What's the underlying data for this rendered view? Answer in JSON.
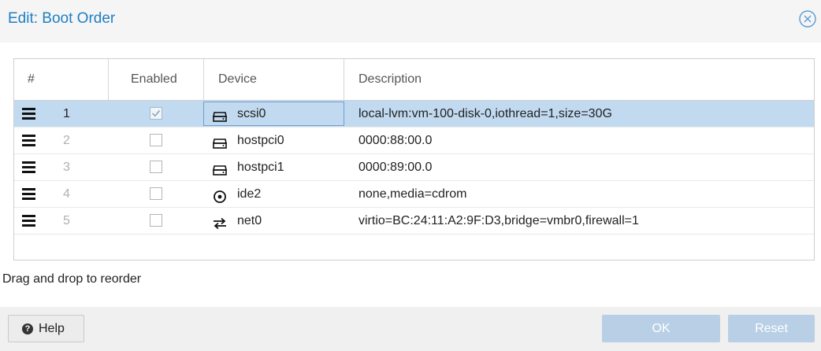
{
  "dialog": {
    "title": "Edit: Boot Order",
    "hint": "Drag and drop to reorder",
    "help_label": "Help",
    "ok_label": "OK",
    "reset_label": "Reset"
  },
  "grid": {
    "columns": [
      "#",
      "Enabled",
      "Device",
      "Description"
    ],
    "rows": [
      {
        "num": "1",
        "enabled": true,
        "device": "scsi0",
        "icon": "hdd-icon",
        "description": "local-lvm:vm-100-disk-0,iothread=1,size=30G",
        "selected": true
      },
      {
        "num": "2",
        "enabled": false,
        "device": "hostpci0",
        "icon": "hdd-icon",
        "description": "0000:88:00.0",
        "selected": false
      },
      {
        "num": "3",
        "enabled": false,
        "device": "hostpci1",
        "icon": "hdd-icon",
        "description": "0000:89:00.0",
        "selected": false
      },
      {
        "num": "4",
        "enabled": false,
        "device": "ide2",
        "icon": "cdrom-icon",
        "description": "none,media=cdrom",
        "selected": false
      },
      {
        "num": "5",
        "enabled": false,
        "device": "net0",
        "icon": "exchange-icon",
        "description": "virtio=BC:24:11:A2:9F:D3,bridge=vmbr0,firewall=1",
        "selected": false
      }
    ]
  },
  "colors": {
    "title": "#1e7fc4",
    "selected_row": "#c1daf0",
    "disabled_button": "#b8cfe5"
  }
}
